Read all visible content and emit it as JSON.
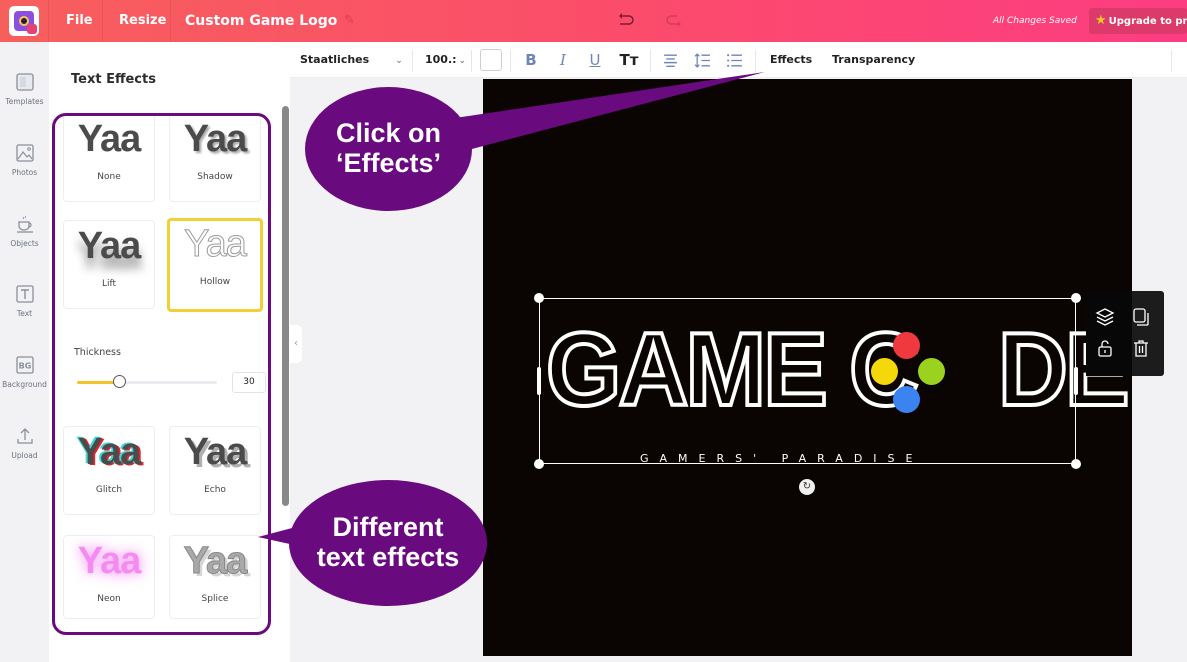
{
  "topbar": {
    "menu": [
      {
        "label": "File"
      },
      {
        "label": "Resize"
      }
    ],
    "document_title": "Custom Game Logo",
    "save_status": "All Changes Saved",
    "upgrade_label": "Upgrade to pro",
    "colors": {
      "gradient_start": "#f75f5d",
      "gradient_end": "#fd3c82"
    }
  },
  "left_rail": {
    "items": [
      {
        "label": "Templates",
        "icon": "templates-icon"
      },
      {
        "label": "Photos",
        "icon": "photos-icon"
      },
      {
        "label": "Objects",
        "icon": "objects-icon"
      },
      {
        "label": "Text",
        "icon": "text-icon"
      },
      {
        "label": "Background",
        "icon": "background-icon",
        "glyph": "BG"
      },
      {
        "label": "Upload",
        "icon": "upload-icon"
      }
    ]
  },
  "panel": {
    "title": "Text Effects",
    "sample_text": "Yaa",
    "effects": [
      {
        "label": "None",
        "selected": false
      },
      {
        "label": "Shadow",
        "selected": false
      },
      {
        "label": "Lift",
        "selected": false
      },
      {
        "label": "Hollow",
        "selected": true
      },
      {
        "label": "Glitch",
        "selected": false
      },
      {
        "label": "Echo",
        "selected": false
      },
      {
        "label": "Neon",
        "selected": false
      },
      {
        "label": "Splice",
        "selected": false
      }
    ],
    "thickness": {
      "label": "Thickness",
      "value": "30",
      "fraction": 0.3
    }
  },
  "toolbar": {
    "font_family": "Staatliches",
    "font_size": "100.:",
    "text_color": "#ffffff",
    "bold": "B",
    "italic": "I",
    "underline": "U",
    "text_case": "Tт",
    "effects_label": "Effects",
    "transparency_label": "Transparency"
  },
  "canvas": {
    "background": "#0a0503",
    "logo_left": "GAME C",
    "logo_right": "DE",
    "tagline": "GAMERS' PARADISE",
    "dpad_colors": {
      "top": "#f0393f",
      "left": "#f5d80a",
      "right": "#9ad21f",
      "bottom": "#3a83f0"
    }
  },
  "annotations": {
    "effects_callout": [
      "Click on",
      "‘Effects’"
    ],
    "text_effects_callout": [
      "Different",
      "text effects"
    ],
    "color": "#690a7e"
  }
}
